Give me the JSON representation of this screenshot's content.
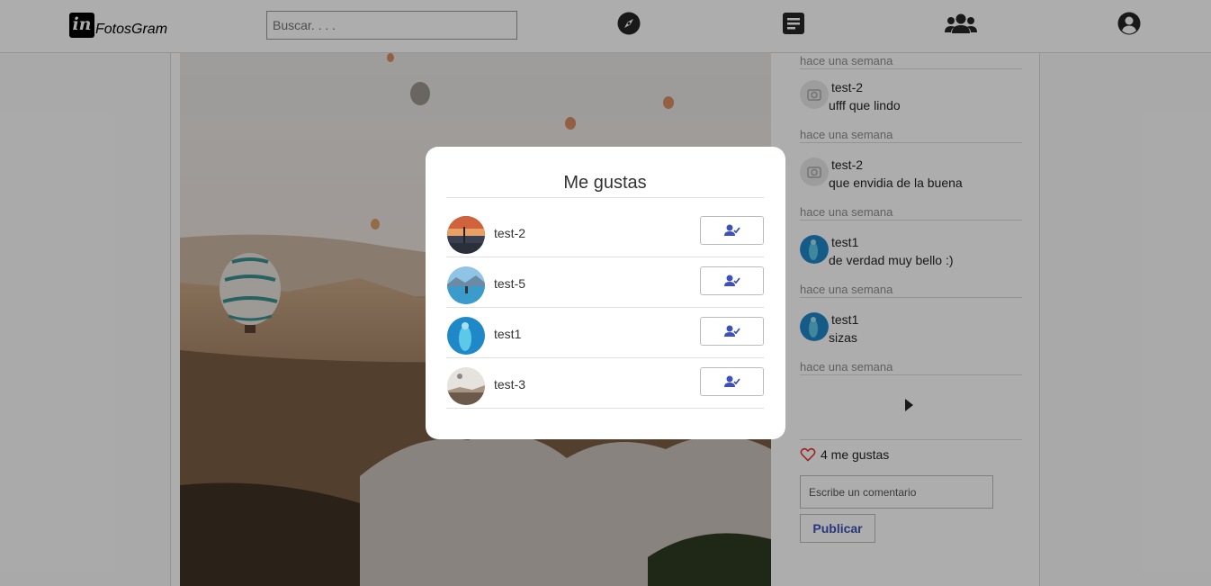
{
  "app": {
    "logo_mark": "in",
    "logo_text": "FotosGram"
  },
  "search": {
    "placeholder": "Buscar. . . ."
  },
  "nav": [
    {
      "icon": "compass-icon"
    },
    {
      "icon": "document-icon"
    },
    {
      "icon": "users-icon"
    },
    {
      "icon": "account-icon"
    }
  ],
  "comments": {
    "top_time": "hace una semana",
    "items": [
      {
        "user": "test-2",
        "text": "ufff que lindo",
        "time": "hace una semana",
        "avatar": "placeholder"
      },
      {
        "user": "test-2",
        "text": "que envidia de la buena",
        "time": "hace una semana",
        "avatar": "placeholder"
      },
      {
        "user": "test1",
        "text": "de verdad muy bello :)",
        "time": "hace una semana",
        "avatar": "blue"
      },
      {
        "user": "test1",
        "text": "sizas",
        "time": "hace una semana",
        "avatar": "blue"
      }
    ]
  },
  "likes": {
    "count_text": "4 me gustas"
  },
  "comment_box": {
    "placeholder": "Escribe un comentario",
    "publish_label": "Publicar"
  },
  "modal": {
    "title": "Me gustas",
    "likers": [
      {
        "name": "test-2",
        "avatar": "sunset"
      },
      {
        "name": "test-5",
        "avatar": "lake"
      },
      {
        "name": "test1",
        "avatar": "blue"
      },
      {
        "name": "test-3",
        "avatar": "balloon"
      }
    ]
  },
  "colors": {
    "accent": "#3f51b5",
    "heart": "#e53935",
    "overlay": "rgba(0,0,0,0.32)"
  }
}
